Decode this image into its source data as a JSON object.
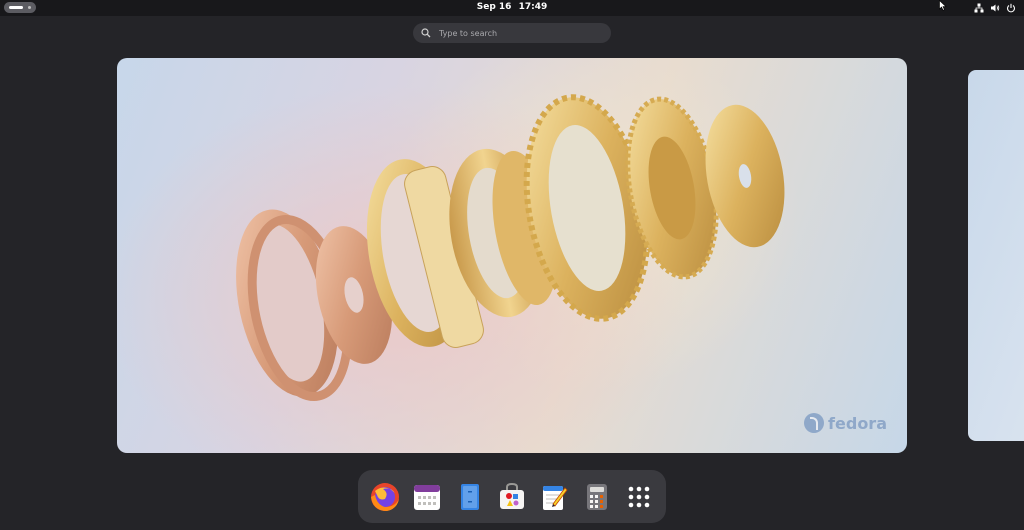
{
  "topbar": {
    "clock_date": "Sep 16",
    "clock_time": "17:49",
    "activities_label": "",
    "tray_icons": [
      "network-icon",
      "volume-icon",
      "power-icon"
    ]
  },
  "search": {
    "placeholder": "Type to search"
  },
  "workspace": {
    "wallpaper_logo_text": "fedora"
  },
  "dash": {
    "apps": [
      {
        "name": "Firefox",
        "icon": "firefox-icon"
      },
      {
        "name": "Calendar",
        "icon": "calendar-icon"
      },
      {
        "name": "Files",
        "icon": "files-icon"
      },
      {
        "name": "Software",
        "icon": "software-icon"
      },
      {
        "name": "Text Editor",
        "icon": "text-editor-icon"
      },
      {
        "name": "Calculator",
        "icon": "calculator-icon"
      },
      {
        "name": "Show Apps",
        "icon": "app-grid-icon"
      }
    ]
  },
  "colors": {
    "panel": "#18181b",
    "background": "#242428",
    "dash": "#3a3a3f",
    "search": "#38383d"
  }
}
